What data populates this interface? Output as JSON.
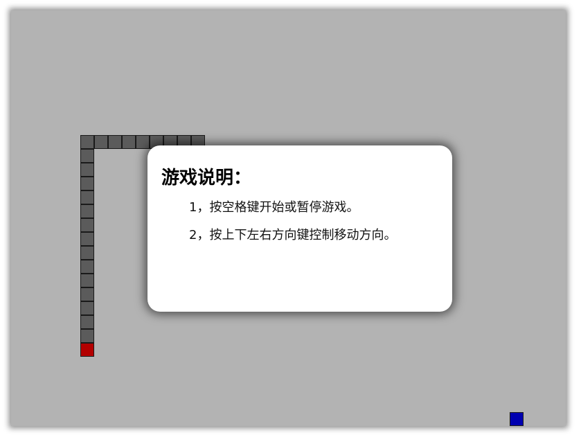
{
  "instructions": {
    "title": "游戏说明：",
    "items": [
      "1，按空格键开始或暂停游戏。",
      "2，按上下左右方向键控制移动方向。"
    ]
  },
  "colors": {
    "board": "#b3b3b3",
    "snake_body": "#5b5b5b",
    "snake_head": "#b30000",
    "food": "#0000b0",
    "dialog_bg": "#ffffff"
  }
}
